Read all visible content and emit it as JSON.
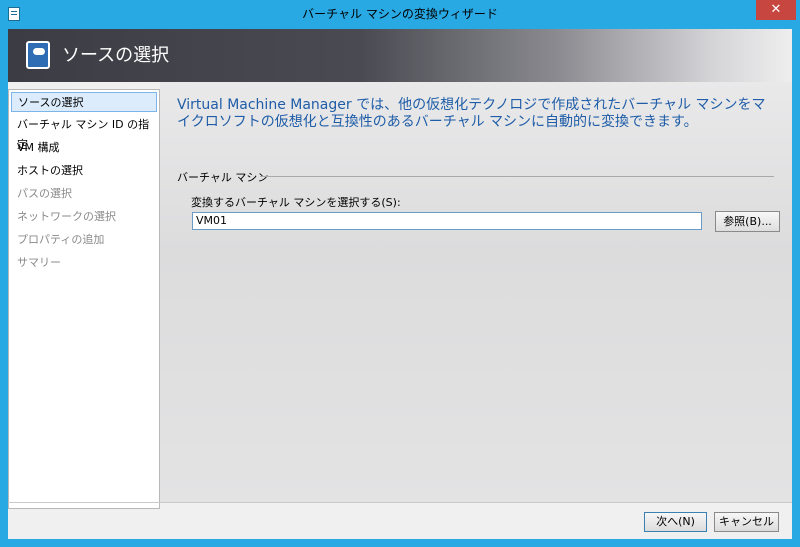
{
  "window": {
    "title": "バーチャル マシンの変換ウィザード",
    "close_label": "✕"
  },
  "banner": {
    "title": "ソースの選択"
  },
  "nav": {
    "items": [
      {
        "label": "ソースの選択"
      },
      {
        "label": "バーチャル マシン ID の指定"
      },
      {
        "label": "VM 構成"
      },
      {
        "label": "ホストの選択"
      },
      {
        "label": "パスの選択"
      },
      {
        "label": "ネットワークの選択"
      },
      {
        "label": "プロパティの追加"
      },
      {
        "label": "サマリー"
      }
    ]
  },
  "main": {
    "intro": "Virtual Machine Manager では、他の仮想化テクノロジで作成されたバーチャル マシンをマイクロソフトの仮想化と互換性のあるバーチャル マシンに自動的に変換できます。",
    "section_label": "バーチャル マシン",
    "field_label": "変換するバーチャル マシンを選択する(S):",
    "vm_value": "VM01",
    "browse_label": "参照(B)..."
  },
  "footer": {
    "next_label": "次へ(N)",
    "cancel_label": "キャンセル"
  }
}
